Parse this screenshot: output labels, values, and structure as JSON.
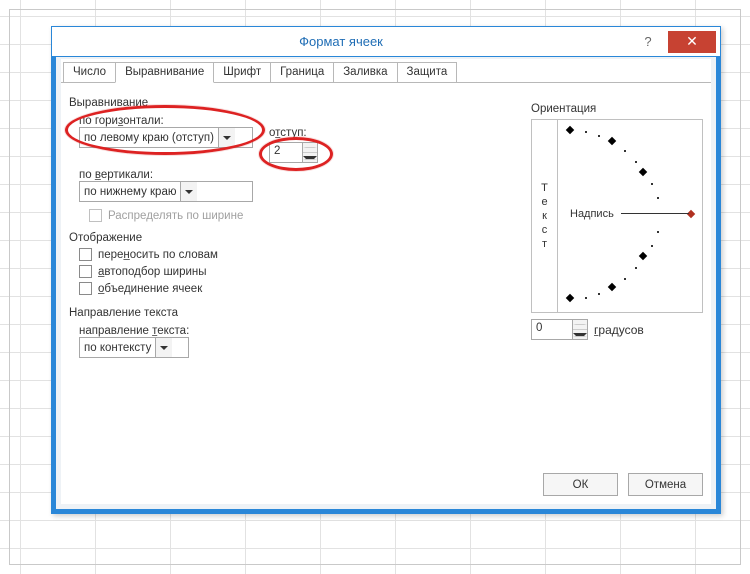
{
  "window": {
    "title": "Формат ячеек",
    "help": "?",
    "close": "✕"
  },
  "tabs": [
    "Число",
    "Выравнивание",
    "Шрифт",
    "Граница",
    "Заливка",
    "Защита"
  ],
  "active_tab": 1,
  "alignment": {
    "group_label": "Выравнивание",
    "horizontal_label": "по горизонтали:",
    "horizontal_value": "по левому краю (отступ)",
    "indent_label": "отступ:",
    "indent_value": "2",
    "vertical_label": "по вертикали:",
    "vertical_value": "по нижнему краю",
    "distribute_label": "Распределять по ширине"
  },
  "display": {
    "group_label": "Отображение",
    "wrap_label": "переносить по словам",
    "autofit_label": "автоподбор ширины",
    "merge_label": "объединение ячеек"
  },
  "direction": {
    "group_label": "Направление текста",
    "label": "направление текста:",
    "value": "по контексту"
  },
  "orientation": {
    "group_label": "Ориентация",
    "vertical_text": "Текст",
    "dial_label": "Надпись",
    "degrees_value": "0",
    "degrees_label": "градусов"
  },
  "buttons": {
    "ok": "ОК",
    "cancel": "Отмена"
  }
}
